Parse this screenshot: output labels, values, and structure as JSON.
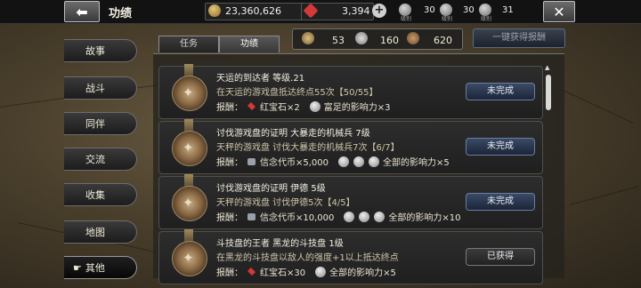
{
  "header": {
    "title": "功绩",
    "gold": "23,360,626",
    "gems": "3,394",
    "badges": [
      {
        "label": "级别",
        "value": "30"
      },
      {
        "label": "级别",
        "value": "30"
      },
      {
        "label": "级别",
        "value": "31"
      }
    ],
    "colors": {
      "bar": "#121212",
      "gem": "#d43838"
    }
  },
  "sidebar": {
    "items": [
      {
        "label": "故事"
      },
      {
        "label": "战斗"
      },
      {
        "label": "同伴"
      },
      {
        "label": "交流"
      },
      {
        "label": "收集"
      },
      {
        "label": "地图"
      },
      {
        "label": "其他",
        "active": true
      }
    ]
  },
  "tabs": [
    {
      "label": "任务"
    },
    {
      "label": "功绩",
      "active": true
    }
  ],
  "stats": {
    "gold_medals": "53",
    "silver_medals": "160",
    "bronze_medals": "620"
  },
  "claim_all_label": "一键获得报酬",
  "achievements": [
    {
      "title": "天运的到达者  等级.21",
      "desc": "在天运的游戏盘抵达终点55次【50/55】",
      "reward_label": "报酬：",
      "reward_1": "红宝石×2",
      "reward_2": "富足的影响力×3",
      "status": "未完成"
    },
    {
      "title": "讨伐游戏盘的证明  大暴走的机械兵  7级",
      "desc": "天秤的游戏盘  讨伐大暴走的机械兵7次【6/7】",
      "reward_label": "报酬：",
      "reward_1": "信念代币×5,000",
      "reward_2": "全部的影响力×5",
      "status": "未完成"
    },
    {
      "title": "讨伐游戏盘的证明  伊德  5级",
      "desc": "天秤的游戏盘  讨伐伊德5次【4/5】",
      "reward_label": "报酬：",
      "reward_1": "信念代币×10,000",
      "reward_2": "全部的影响力×10",
      "status": "未完成"
    },
    {
      "title": "斗技盘的王者  黑龙的斗技盘  1级",
      "desc": "在黑龙的斗技盘以敌人的强度+1以上抵达终点",
      "reward_label": "报酬：",
      "reward_1": "红宝石×30",
      "reward_2": "全部的影响力×5",
      "status": "已获得"
    }
  ]
}
